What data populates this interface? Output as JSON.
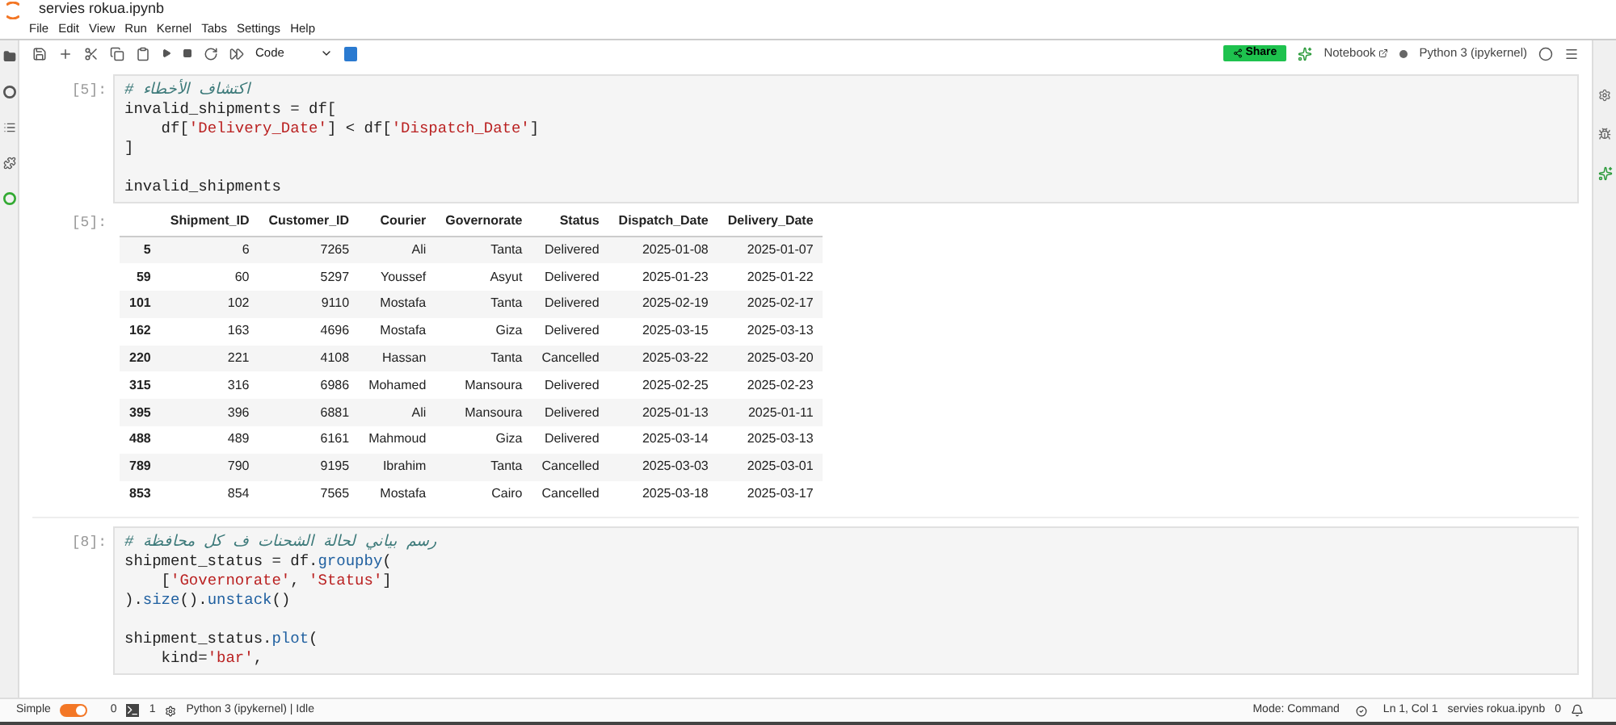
{
  "window": {
    "title": "servies rokua.ipynb"
  },
  "menu": [
    "File",
    "Edit",
    "View",
    "Run",
    "Kernel",
    "Tabs",
    "Settings",
    "Help"
  ],
  "toolbar": {
    "cell_type": "Code",
    "share": "Share",
    "notebook": "Notebook",
    "kernel": "Python 3 (ipykernel)"
  },
  "cells": [
    {
      "kind": "code",
      "prompt": "[5]:",
      "lines": [
        [
          {
            "kind": "comment",
            "text": "# اكتشاف الأخطاء"
          }
        ],
        [
          {
            "kind": "plain",
            "text": "invalid_shipments = df["
          }
        ],
        [
          {
            "kind": "plain",
            "text": "    df["
          },
          {
            "kind": "string",
            "text": "'Delivery_Date'"
          },
          {
            "kind": "plain",
            "text": "] < df["
          },
          {
            "kind": "string",
            "text": "'Dispatch_Date'"
          },
          {
            "kind": "plain",
            "text": "]"
          }
        ],
        [
          {
            "kind": "plain",
            "text": "]"
          }
        ],
        [
          {
            "kind": "plain",
            "text": "invalid_shipments",
            "gap_before": true
          }
        ]
      ]
    },
    {
      "kind": "table",
      "prompt": "[5]:",
      "columns": [
        "",
        "Shipment_ID",
        "Customer_ID",
        "Courier",
        "Governorate",
        "Status",
        "Dispatch_Date",
        "Delivery_Date"
      ],
      "rows": [
        [
          "5",
          "6",
          "7265",
          "Ali",
          "Tanta",
          "Delivered",
          "2025-01-08",
          "2025-01-07"
        ],
        [
          "59",
          "60",
          "5297",
          "Youssef",
          "Asyut",
          "Delivered",
          "2025-01-23",
          "2025-01-22"
        ],
        [
          "101",
          "102",
          "9110",
          "Mostafa",
          "Tanta",
          "Delivered",
          "2025-02-19",
          "2025-02-17"
        ],
        [
          "162",
          "163",
          "4696",
          "Mostafa",
          "Giza",
          "Delivered",
          "2025-03-15",
          "2025-03-13"
        ],
        [
          "220",
          "221",
          "4108",
          "Hassan",
          "Tanta",
          "Cancelled",
          "2025-03-22",
          "2025-03-20"
        ],
        [
          "315",
          "316",
          "6986",
          "Mohamed",
          "Mansoura",
          "Delivered",
          "2025-02-25",
          "2025-02-23"
        ],
        [
          "395",
          "396",
          "6881",
          "Ali",
          "Mansoura",
          "Delivered",
          "2025-01-13",
          "2025-01-11"
        ],
        [
          "488",
          "489",
          "6161",
          "Mahmoud",
          "Giza",
          "Delivered",
          "2025-03-14",
          "2025-03-13"
        ],
        [
          "789",
          "790",
          "9195",
          "Ibrahim",
          "Tanta",
          "Cancelled",
          "2025-03-03",
          "2025-03-01"
        ],
        [
          "853",
          "854",
          "7565",
          "Mostafa",
          "Cairo",
          "Cancelled",
          "2025-03-18",
          "2025-03-17"
        ]
      ]
    },
    {
      "kind": "code",
      "prompt": "[8]:",
      "lines": [
        [
          {
            "kind": "comment",
            "text": "# رسم بياني لحالة الشحنات ف كل محافظة"
          }
        ],
        [
          {
            "kind": "plain",
            "text": "shipment_status = df."
          },
          {
            "kind": "func",
            "text": "groupby"
          },
          {
            "kind": "plain",
            "text": "("
          }
        ],
        [
          {
            "kind": "plain",
            "text": "    ["
          },
          {
            "kind": "string",
            "text": "'Governorate'"
          },
          {
            "kind": "plain",
            "text": ", "
          },
          {
            "kind": "string",
            "text": "'Status'"
          },
          {
            "kind": "plain",
            "text": "]"
          }
        ],
        [
          {
            "kind": "plain",
            "text": ")."
          },
          {
            "kind": "func",
            "text": "size"
          },
          {
            "kind": "plain",
            "text": "()."
          },
          {
            "kind": "func",
            "text": "unstack"
          },
          {
            "kind": "plain",
            "text": "()"
          }
        ],
        [
          {
            "kind": "plain",
            "text": "shipment_status.",
            "gap_before": true
          },
          {
            "kind": "func",
            "text": "plot"
          },
          {
            "kind": "plain",
            "text": "("
          }
        ],
        [
          {
            "kind": "plain",
            "text": "    kind="
          },
          {
            "kind": "string",
            "text": "'bar'"
          },
          {
            "kind": "plain",
            "text": ","
          }
        ]
      ]
    }
  ],
  "status_bar": {
    "mode_label": "Simple",
    "simple_on": true,
    "terminals": "0",
    "kernels": "1",
    "kernel_status": "Python 3 (ipykernel) | Idle",
    "mode": "Mode: Command",
    "position": "Ln 1, Col 1",
    "file": "servies rokua.ipynb",
    "notifications": "0"
  }
}
